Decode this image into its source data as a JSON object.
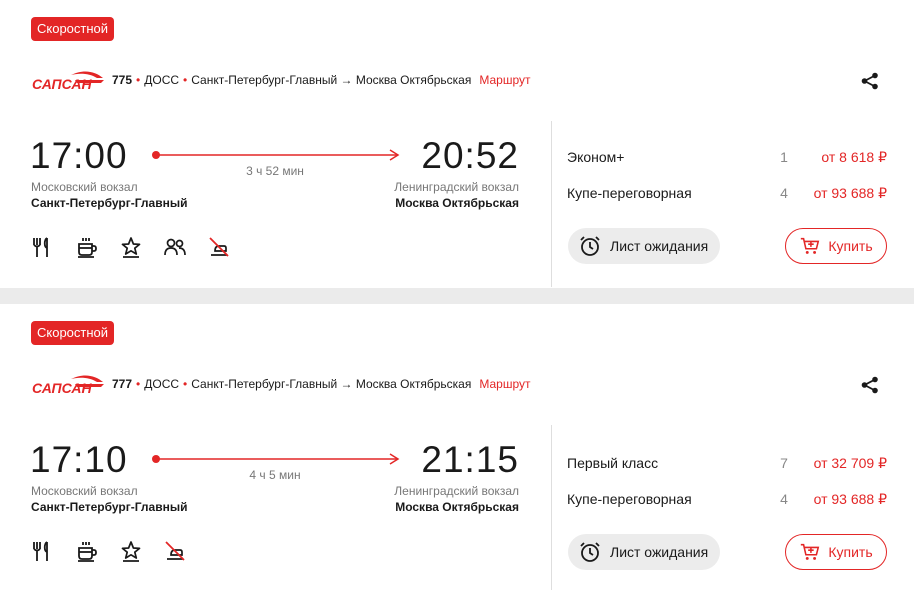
{
  "trains": [
    {
      "badge": "Скоростной",
      "number": "775",
      "carrier": "ДОСС",
      "route": "Санкт-Петербург-Главный → Москва Октябрьская",
      "route_link": "Маршрут",
      "departure_time": "17:00",
      "arrival_time": "20:52",
      "duration": "3 ч 52 мин",
      "departure_station": "Московский вокзал",
      "departure_city": "Санкт-Петербург-Главный",
      "arrival_station": "Ленинградский вокзал",
      "arrival_city": "Москва Октябрьская",
      "amenities": [
        "fork-knife-icon",
        "coffee-cup-icon",
        "star-icon",
        "people-icon",
        "no-pets-icon"
      ],
      "fares": [
        {
          "class": "Эконом+",
          "seats": "1",
          "price": "от 8 618 ₽"
        },
        {
          "class": "Купе-переговорная",
          "seats": "4",
          "price": "от 93 688 ₽"
        }
      ],
      "wait_label": "Лист ожидания",
      "buy_label": "Купить"
    },
    {
      "badge": "Скоростной",
      "number": "777",
      "carrier": "ДОСС",
      "route": "Санкт-Петербург-Главный → Москва Октябрьская",
      "route_link": "Маршрут",
      "departure_time": "17:10",
      "arrival_time": "21:15",
      "duration": "4 ч 5 мин",
      "departure_station": "Московский вокзал",
      "departure_city": "Санкт-Петербург-Главный",
      "arrival_station": "Ленинградский вокзал",
      "arrival_city": "Москва Октябрьская",
      "amenities": [
        "fork-knife-icon",
        "coffee-cup-icon",
        "star-icon",
        "no-pets-icon"
      ],
      "fares": [
        {
          "class": "Первый класс",
          "seats": "7",
          "price": "от 32 709 ₽"
        },
        {
          "class": "Купе-переговорная",
          "seats": "4",
          "price": "от 93 688 ₽"
        }
      ],
      "wait_label": "Лист ожидания",
      "buy_label": "Купить"
    }
  ],
  "colors": {
    "accent": "#e32626",
    "text": "#1a1a1a",
    "muted": "#777777",
    "separator": "#ebebeb"
  }
}
